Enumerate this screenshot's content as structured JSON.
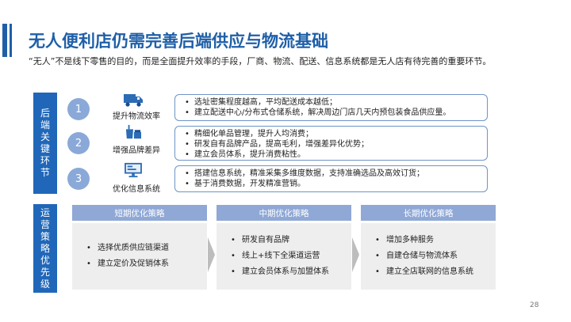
{
  "slide": {
    "title": "无人便利店仍需完善后端供应与物流基础",
    "intro": "“无人”不是线下零售的目的，而是全面提升效率的手段，厂商、物流、配送、信息系统都是无人店有待完善的重要环节。",
    "accent_color": "#1f5fa8",
    "page_number": "28"
  },
  "key_links": {
    "label": "后端关键环节",
    "rows": [
      {
        "number": "1",
        "icon": "delivery-truck-icon",
        "label": "提升物流效率",
        "bullets": [
          "选址密集程度越高，平均配送成本越低；",
          "建立配送中心/分布式仓储系统，解决周边门店几天内预包装食品供应量。"
        ]
      },
      {
        "number": "2",
        "icon": "drink-cup-icon",
        "label": "增强品牌差异",
        "bullets": [
          "精细化单品管理，提升人均消费；",
          "研发自有品牌产品，提高毛利，增强差异化优势；",
          "建立会员体系，提升消费粘性。"
        ]
      },
      {
        "number": "3",
        "icon": "monitor-icon",
        "label": "优化信息系统",
        "bullets": [
          "搭建信息系统，精准采集多维度数据，支持准确选品及高效订货；",
          "基于消费数据，开发精准营销。"
        ]
      }
    ]
  },
  "strategy": {
    "label": "运营策略优先级",
    "columns": [
      {
        "header": "短期优化策略",
        "items": [
          "选择优质供应链渠道",
          "建立定价及促销体系"
        ]
      },
      {
        "header": "中期优化策略",
        "items": [
          "研发自有品牌",
          "线上+线下全渠道运营",
          "建立会员体系与加盟体系"
        ]
      },
      {
        "header": "长期优化策略",
        "items": [
          "增加多种服务",
          "自建仓储与物流体系",
          "建立全店联网的信息系统"
        ]
      }
    ]
  }
}
